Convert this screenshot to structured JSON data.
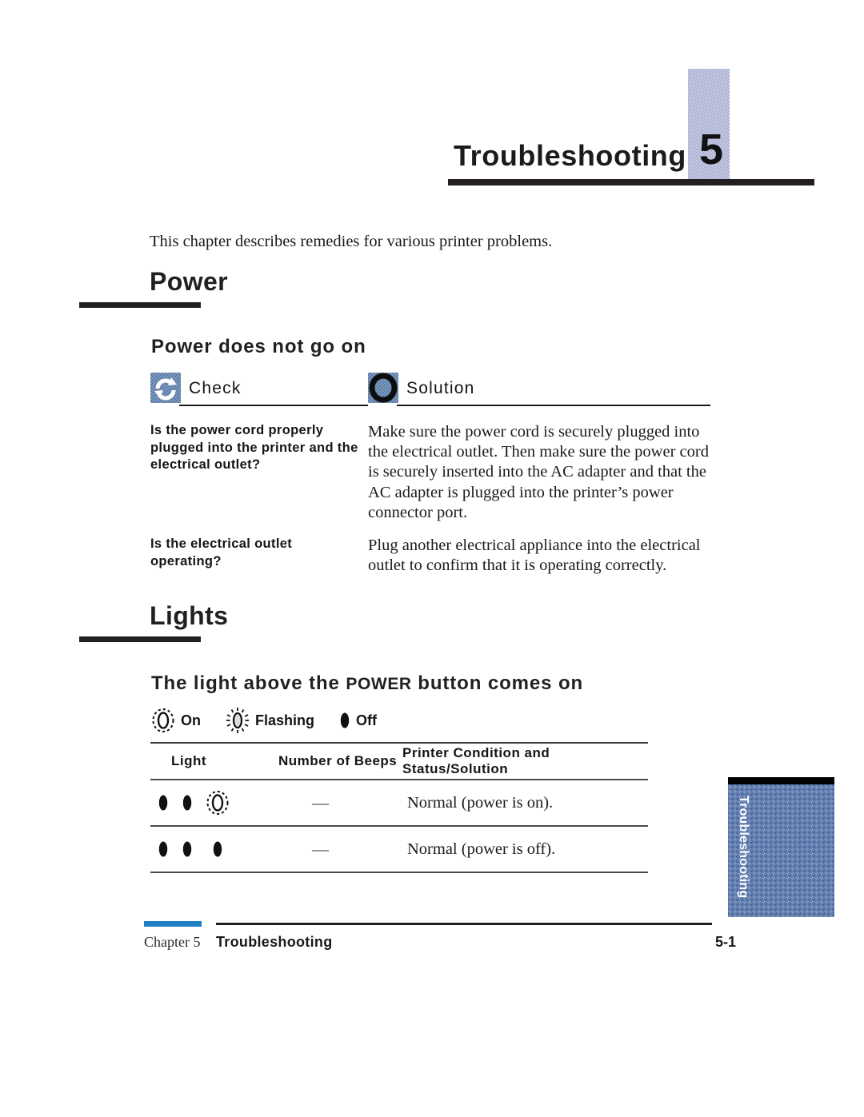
{
  "chapter": {
    "number": "5",
    "title": "Troubleshooting",
    "intro": "This chapter describes remedies for various printer problems."
  },
  "sections": [
    {
      "heading": "Power",
      "subheading": "Power does not go on",
      "table": {
        "check_label": "Check",
        "solution_label": "Solution",
        "check_icon": "refresh-circular-arrow-icon",
        "solution_icon": "filled-ring-icon",
        "rows": [
          {
            "check": "Is the power cord properly plugged into the printer and the electrical outlet?",
            "solution": "Make sure the power cord is securely plugged into the electrical outlet. Then make sure the power cord is securely inserted into the AC adapter and that the AC adapter is plugged into the printer’s power connector port."
          },
          {
            "check": "Is the electrical outlet operating?",
            "solution": "Plug another electrical appliance into the electrical outlet to confirm that it is operating correctly."
          }
        ]
      }
    },
    {
      "heading": "Lights",
      "subheading_prefix": "The light above the ",
      "subheading_caps": "POWER",
      "subheading_suffix": " button comes on",
      "legend": [
        {
          "state": "on",
          "label": "On",
          "icon": "lamp-on-icon"
        },
        {
          "state": "flashing",
          "label": "Flashing",
          "icon": "lamp-flashing-icon"
        },
        {
          "state": "off",
          "label": "Off",
          "icon": "lamp-off-icon"
        }
      ],
      "table": {
        "headers": [
          "Light",
          "Number of Beeps",
          "Printer Condition and Status/Solution"
        ],
        "rows": [
          {
            "lights": [
              "off",
              "off",
              "on"
            ],
            "beeps": "—",
            "condition": "Normal (power is on)."
          },
          {
            "lights": [
              "off",
              "off",
              "off"
            ],
            "beeps": "—",
            "condition": "Normal (power is off)."
          }
        ]
      }
    }
  ],
  "side_tab": {
    "label": "Troubleshooting"
  },
  "footer": {
    "chapter": "Chapter 5",
    "title": "Troubleshooting",
    "page": "5-1"
  },
  "colors": {
    "accent_blue": "#1f7fc0",
    "tab_blue": "#5f82ad",
    "icon_blue": "#7d98bd",
    "chapter_block": "#c3c8e0",
    "ink": "#231f20"
  }
}
